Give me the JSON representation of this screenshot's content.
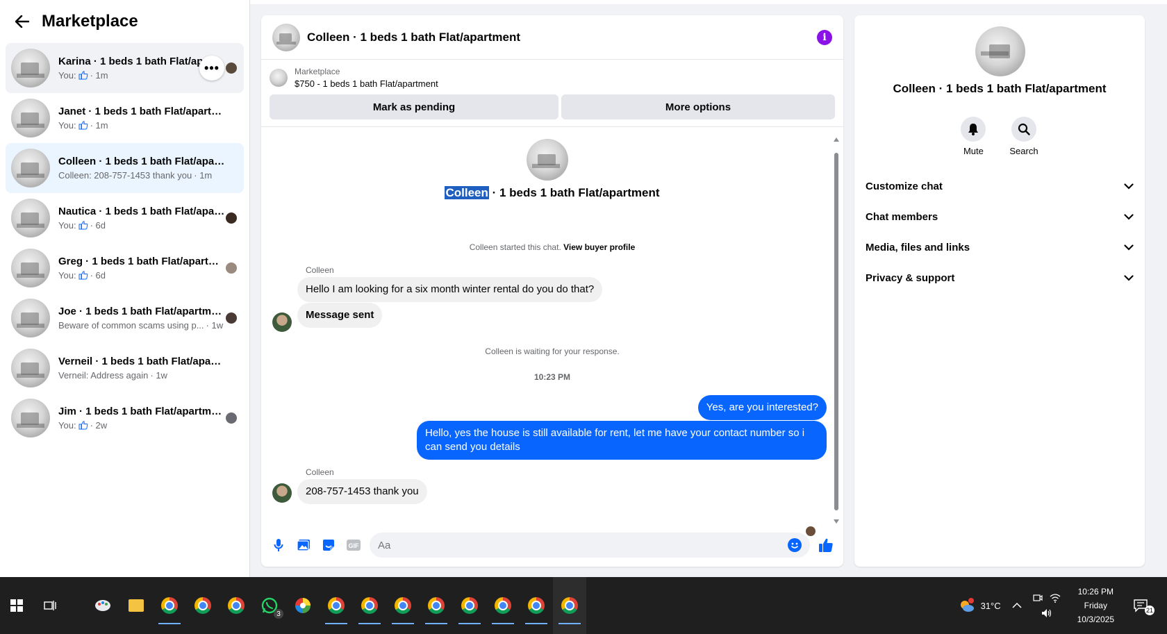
{
  "sidebar": {
    "title": "Marketplace",
    "conversations": [
      {
        "name": "Karina · 1 beds 1 bath Flat/apartment",
        "prefix": "You:",
        "preview": "",
        "like": true,
        "time": "· 1m"
      },
      {
        "name": "Janet · 1 beds 1 bath Flat/apartment",
        "prefix": "You:",
        "preview": "",
        "like": true,
        "time": "· 1m"
      },
      {
        "name": "Colleen · 1 beds 1 bath Flat/apartm...",
        "prefix": "",
        "preview": "Colleen: 208-757-1453 thank you",
        "like": false,
        "time": "· 1m"
      },
      {
        "name": "Nautica · 1 beds 1 bath Flat/apar...",
        "prefix": "You:",
        "preview": "",
        "like": true,
        "time": "· 6d"
      },
      {
        "name": "Greg · 1 beds 1 bath Flat/apartm...",
        "prefix": "You:",
        "preview": "",
        "like": true,
        "time": "· 6d"
      },
      {
        "name": "Joe · 1 beds 1 bath Flat/apartment",
        "prefix": "",
        "preview": "Beware of common scams using p...",
        "like": false,
        "time": "· 1w"
      },
      {
        "name": "Verneil · 1 beds 1 bath Flat/apartm...",
        "prefix": "",
        "preview": "Verneil: Address again",
        "like": false,
        "time": "· 1w"
      },
      {
        "name": "Jim · 1 beds 1 bath Flat/apartment",
        "prefix": "You:",
        "preview": "",
        "like": true,
        "time": "· 2w"
      }
    ],
    "more_glyph": "•••"
  },
  "chat": {
    "header_title": "Colleen · 1 beds 1 bath Flat/apartment",
    "info_glyph": "i",
    "listing_label": "Marketplace",
    "listing_price": "$750 - 1 beds 1 bath Flat/apartment",
    "mark_pending": "Mark as pending",
    "more_options": "More options",
    "thread_title_highlight": "Colleen",
    "thread_title_rest": " · 1 beds 1 bath Flat/apartment",
    "started_text": "Colleen started this chat.",
    "view_profile": "View buyer profile",
    "sender1": "Colleen",
    "msg1": "Hello I am looking for a six month winter rental do you do that?",
    "msg2": "Message sent",
    "waiting": "Colleen is waiting for your response.",
    "time_divider": "10:23 PM",
    "out1": "Yes, are you interested?",
    "out2": "Hello, yes the house is still available for rent, let me have your contact number so i can send you details",
    "sender2": "Colleen",
    "msg3": "208-757-1453 thank you",
    "composer_placeholder": "Aa"
  },
  "details": {
    "title": "Colleen · 1 beds 1 bath Flat/apartment",
    "mute_label": "Mute",
    "search_label": "Search",
    "sections": [
      "Customize chat",
      "Chat members",
      "Media, files and links",
      "Privacy & support"
    ]
  },
  "taskbar": {
    "whatsapp_badge": "3",
    "temperature": "31°C",
    "time": "10:26 PM",
    "day": "Friday",
    "date": "10/3/2025",
    "notif_count": "21"
  },
  "colors": {
    "accent": "#0866ff",
    "info": "#8a12e6",
    "active_row": "#ebf5ff"
  }
}
